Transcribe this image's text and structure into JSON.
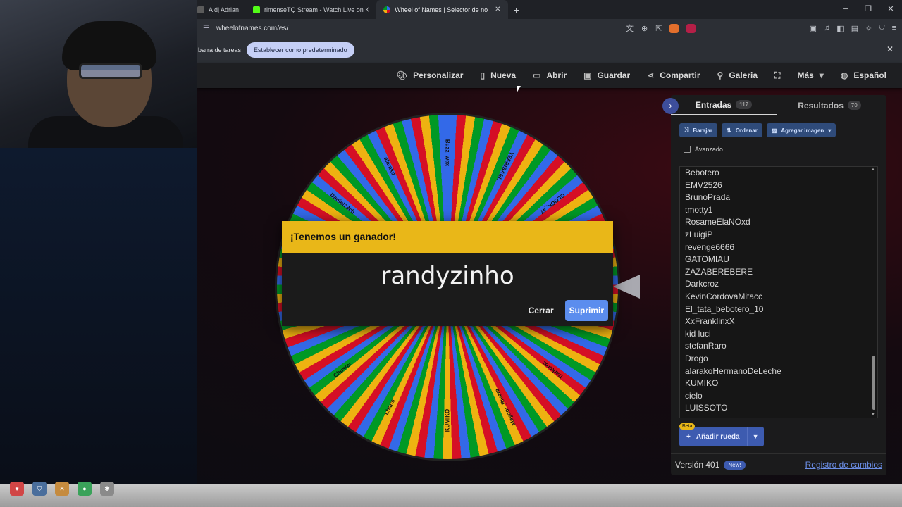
{
  "browser": {
    "tabs": [
      {
        "title": "A dj Adrian",
        "active": false,
        "color": "#5b5b5b"
      },
      {
        "title": "rimenseTQ Stream - Watch Live on K",
        "active": false,
        "color": "#53fc18"
      },
      {
        "title": "Wheel of Names | Selector de no",
        "active": true,
        "color": "#e8b83a"
      }
    ],
    "new_tab": "+",
    "url": "wheelofnames.com/es/"
  },
  "infobar": {
    "text": "barra de tareas",
    "button": "Establecer como predeterminado"
  },
  "menu": {
    "items": [
      {
        "label": "Personalizar",
        "icon": "palette-icon"
      },
      {
        "label": "Nueva",
        "icon": "file-icon"
      },
      {
        "label": "Abrir",
        "icon": "folder-icon"
      },
      {
        "label": "Guardar",
        "icon": "save-icon"
      },
      {
        "label": "Compartir",
        "icon": "share-icon"
      },
      {
        "label": "Galeria",
        "icon": "search-icon"
      },
      {
        "label": "",
        "icon": "fullscreen-icon"
      },
      {
        "label": "Más",
        "icon": "chevron-down-icon"
      },
      {
        "label": "Español",
        "icon": "globe-icon"
      }
    ]
  },
  "winner_dialog": {
    "title": "¡Tenemos un ganador!",
    "name": "randyzinho",
    "close_label": "Cerrar",
    "delete_label": "Suprimir",
    "header_color": "#e9b718"
  },
  "wheel": {
    "colors": [
      "#3369e8",
      "#d50f25",
      "#eeb211",
      "#009925"
    ],
    "labels": [
      "Buzz_wex",
      "YEFRISAEL",
      "GLOCK_47",
      "Enrique_Carmona",
      "pata",
      "Darkcroz",
      "Maynor_Rivera",
      "KUMIKO",
      "Lhans",
      "Chuster",
      "kid luci",
      "randyzinho",
      "Daniel23ch",
      "alarako"
    ]
  },
  "panel": {
    "tab_entries": "Entradas",
    "entries_count": "117",
    "tab_results": "Resultados",
    "results_count": "70",
    "shuffle": "Barajar",
    "sort": "Ordenar",
    "add_image": "Agregar imagen",
    "advanced": "Avanzado",
    "entries": [
      "Bebotero",
      "EMV2526",
      "BrunoPrada",
      "tmotty1",
      "RosameElaNOxd",
      "zLuigiP",
      "revenge6666",
      "GATOMIAU",
      "ZAZABEREBERE",
      "Darkcroz",
      "KevinCordovaMitacc",
      "El_tata_bebotero_10",
      "XxFranklinxX",
      "kid luci",
      "stefanRaro",
      "Drogo",
      "alarakoHermanoDeLeche",
      "KUMIKO",
      "cielo",
      "LUISSOTO"
    ],
    "beta": "Beta",
    "add_wheel": "Añadir rueda",
    "version": "Versión 401",
    "new_badge": "New!",
    "changelog": "Registro de cambios"
  }
}
